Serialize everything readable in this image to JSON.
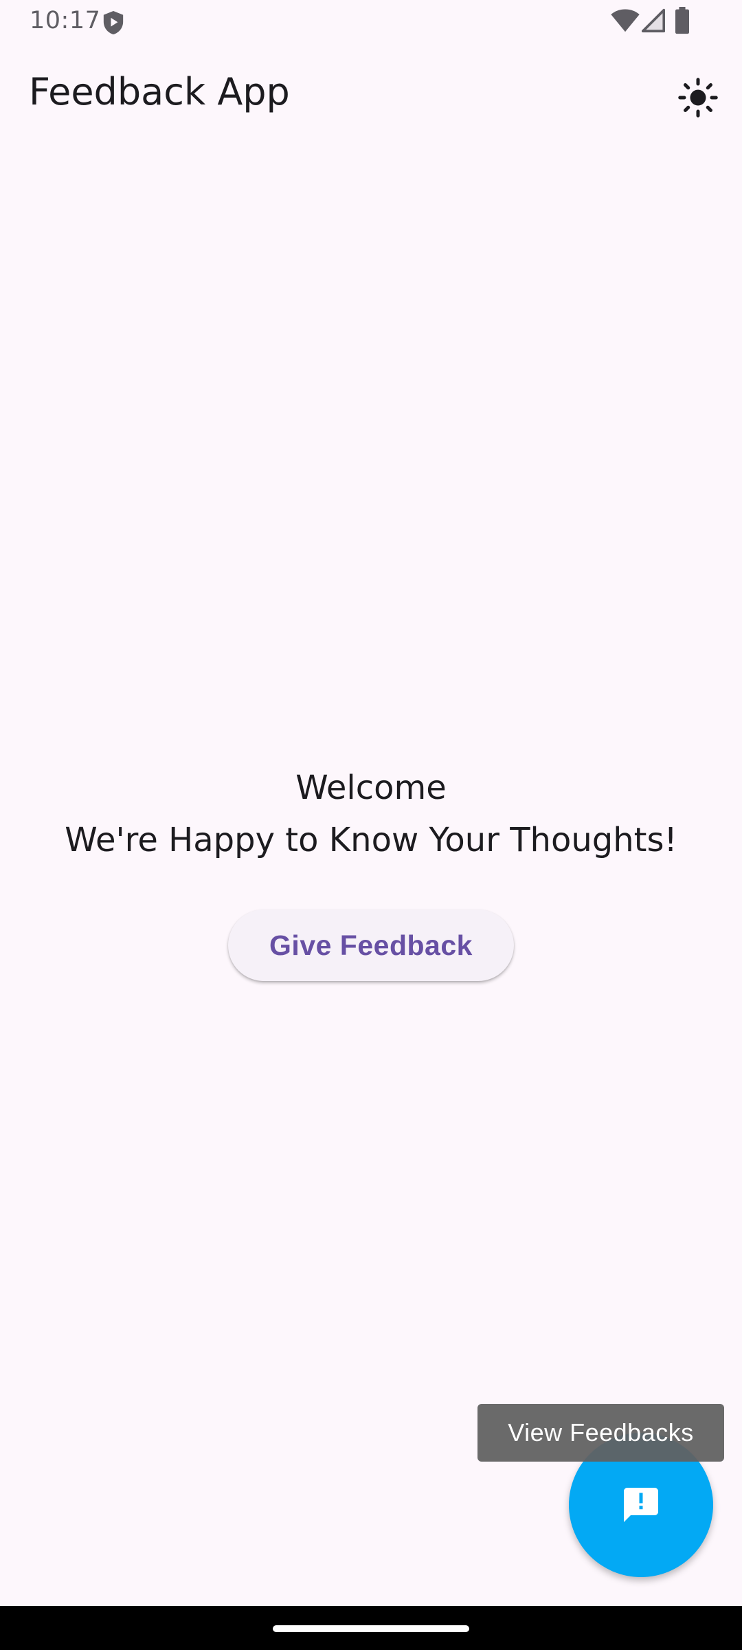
{
  "status_bar": {
    "time": "10:17",
    "icons": [
      "shield-icon",
      "wifi-icon",
      "signal-icon",
      "battery-icon"
    ]
  },
  "app_bar": {
    "title": "Feedback App",
    "theme_icon": "sun-icon"
  },
  "main": {
    "welcome_title": "Welcome",
    "welcome_subtitle": "We're Happy to Know Your Thoughts!",
    "give_feedback_label": "Give Feedback"
  },
  "fab": {
    "tooltip": "View Feedbacks",
    "icon": "feedback-icon"
  },
  "colors": {
    "background": "#FDF7FC",
    "primary": "#6750A4",
    "fab": "#03A9F4",
    "tooltip": "#616161"
  }
}
